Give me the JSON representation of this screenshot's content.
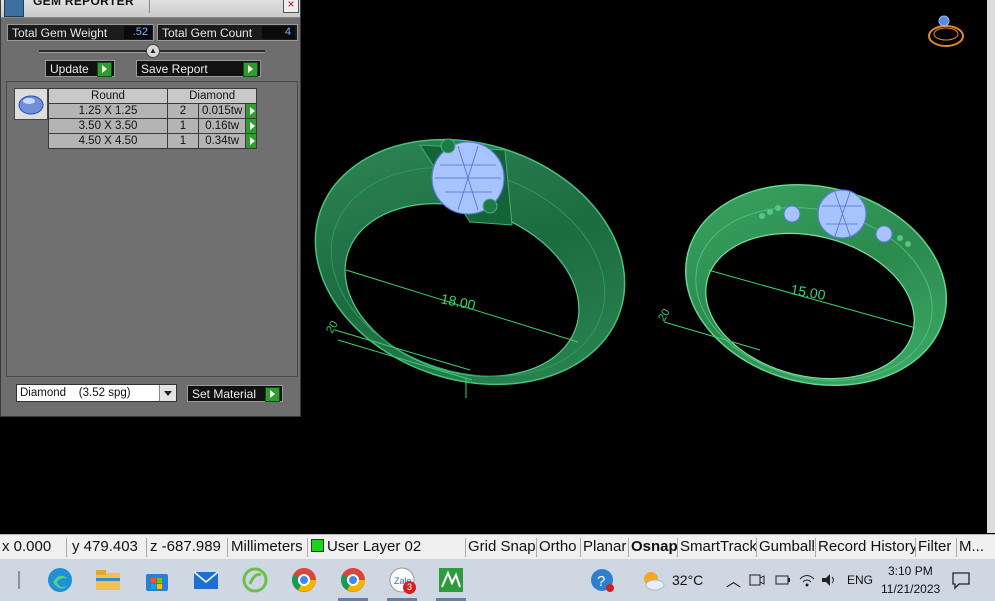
{
  "panel": {
    "title": "GEM REPORTER",
    "close_label": "×",
    "total_weight_label": "Total Gem Weight",
    "total_weight_value": ".52",
    "total_count_label": "Total Gem Count",
    "total_count_value": "4",
    "update_label": "Update",
    "save_report_label": "Save Report",
    "table": {
      "headers": [
        "Round",
        "Diamond"
      ],
      "rows": [
        {
          "size": "1.25 X 1.25",
          "qty": "2",
          "weight": "0.015tw"
        },
        {
          "size": "3.50 X 3.50",
          "qty": "1",
          "weight": "0.16tw"
        },
        {
          "size": "4.50 X 4.50",
          "qty": "1",
          "weight": "0.34tw"
        }
      ]
    },
    "material_value": "Diamond    (3.52 spg)",
    "set_material_label": "Set Material"
  },
  "viewport": {
    "dimension_left": "18.00",
    "dimension_right": "15.00",
    "callout_left": "20",
    "callout_right": "20",
    "ring_color": "#1f7a4a",
    "gem_color": "#8fb4ff"
  },
  "statusbar": {
    "x": "x 0.000",
    "y": "y 479.403",
    "z": "z -687.989",
    "units": "Millimeters",
    "layer": "User Layer 02",
    "toggles": [
      "Grid Snap",
      "Ortho",
      "Planar",
      "Osnap",
      "SmartTrack",
      "Gumball",
      "Record History",
      "Filter",
      "M..."
    ]
  },
  "taskbar": {
    "weather": "32°C",
    "language": "ENG",
    "time": "3:10 PM",
    "date": "11/21/2023",
    "badge_count": "3"
  }
}
